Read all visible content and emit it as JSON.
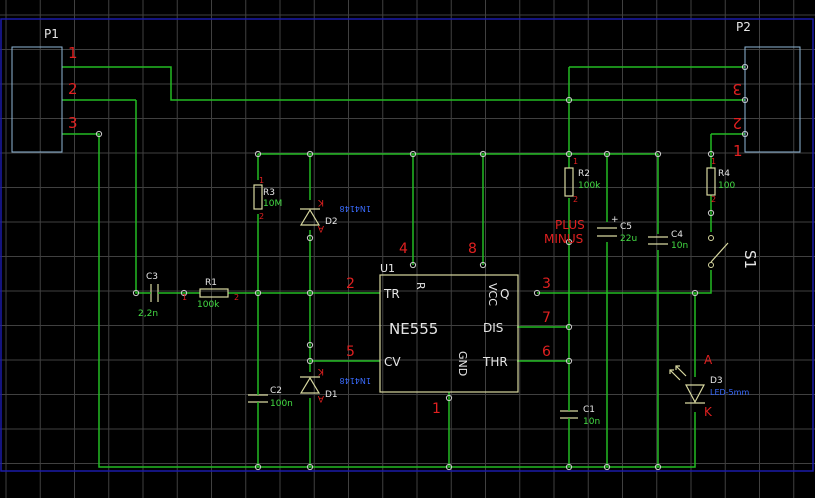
{
  "connectors": {
    "p1": {
      "designator": "P1",
      "pins": [
        "1",
        "2",
        "3"
      ]
    },
    "p2": {
      "designator": "P2",
      "pins": [
        "3",
        "2",
        "1"
      ]
    }
  },
  "ic": {
    "designator": "U1",
    "name": "NE555",
    "pin_labels": {
      "tr": "TR",
      "r": "R",
      "vcc": "VCC",
      "q": "Q",
      "dis": "DIS",
      "cv": "CV",
      "gnd": "GND",
      "thr": "THR"
    },
    "pin_numbers": {
      "tr": "2",
      "r": "4",
      "vcc": "8",
      "q": "3",
      "dis": "7",
      "cv": "5",
      "gnd": "1",
      "thr": "6"
    }
  },
  "components": {
    "r1": {
      "designator": "R1",
      "value": "100k",
      "pins": [
        "1",
        "2"
      ]
    },
    "r2": {
      "designator": "R2",
      "value": "100k",
      "pins": [
        "1",
        "2"
      ]
    },
    "r3": {
      "designator": "R3",
      "value": "10M",
      "pins": [
        "1",
        "2"
      ]
    },
    "r4": {
      "designator": "R4",
      "value": "100",
      "pins": [
        "1",
        "2"
      ]
    },
    "c1": {
      "designator": "C1",
      "value": "10n"
    },
    "c2": {
      "designator": "C2",
      "value": "100n"
    },
    "c3": {
      "designator": "C3",
      "value": "2,2n"
    },
    "c4": {
      "designator": "C4",
      "value": "10n"
    },
    "c5": {
      "designator": "C5",
      "value": "22u",
      "plus": "+"
    },
    "d1": {
      "designator": "D1",
      "value": "1N4148",
      "anode": "A",
      "cathode": "K"
    },
    "d2": {
      "designator": "D2",
      "value": "1N4148",
      "anode": "A",
      "cathode": "K"
    },
    "d3": {
      "designator": "D3",
      "value": "LED-5mm",
      "anode": "A",
      "cathode": "K"
    },
    "s1": {
      "designator": "S1"
    }
  },
  "net_labels": {
    "plus": "PLUS",
    "minus": "MINUS"
  },
  "colors": {
    "background": "#000000",
    "grid": "#404040",
    "wire": "#22bb22",
    "pin_number": "#e02020",
    "designator": "#e6e6e6",
    "value": "#44dd44",
    "diode_value": "#3a6cff",
    "component_body": "#d8d8a0",
    "sheet_border": "#1a1aa8"
  }
}
